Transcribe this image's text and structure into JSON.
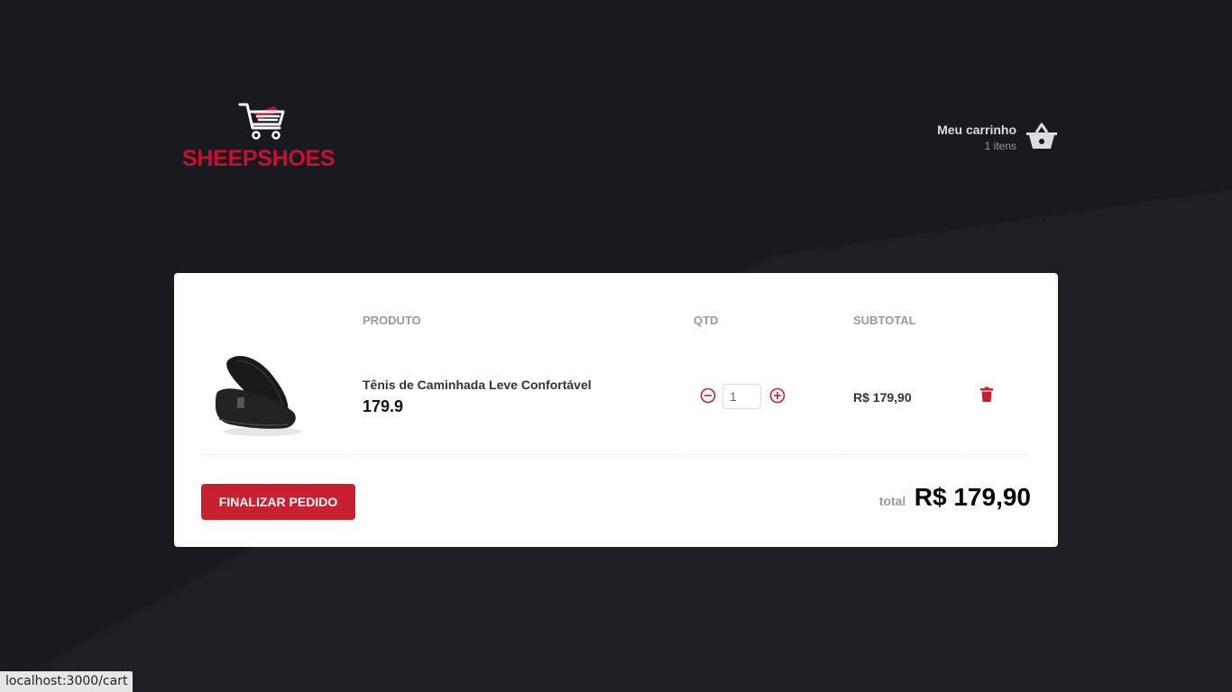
{
  "header": {
    "logo_text": "SHEEPSHOES",
    "cart_title": "Meu carrinho",
    "cart_count": "1 itens"
  },
  "table": {
    "columns": [
      "PRODUTO",
      "QTD",
      "SUBTOTAL"
    ],
    "items": [
      {
        "title": "Tênis de Caminhada Leve Confortável",
        "price": "179.9",
        "quantity": "1",
        "subtotal": "R$ 179,90"
      }
    ]
  },
  "footer": {
    "checkout_label": "FINALIZAR PEDIDO",
    "total_label": "total",
    "total_value": "R$ 179,90"
  },
  "status_bar": {
    "url": "localhost:3000/cart"
  },
  "colors": {
    "background": "#191920",
    "accent": "#c8202f",
    "panel": "#ffffff"
  }
}
